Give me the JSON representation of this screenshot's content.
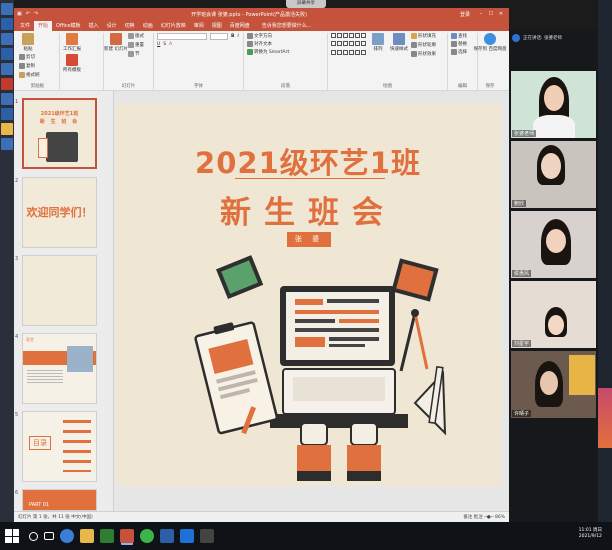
{
  "notice": "屏幕共享",
  "window": {
    "title": "开学班会课 张婆.pptx - PowerPoint(产品激活失败)",
    "sign_in": "登录",
    "qat": [
      "↶",
      "↷",
      "▣"
    ]
  },
  "ribbon_tabs": [
    "文件",
    "开始",
    "Office模板",
    "插入",
    "设计",
    "切换",
    "动画",
    "幻灯片放映",
    "审阅",
    "视图",
    "百度网盘"
  ],
  "tell_me": "告诉我您想要做什么...",
  "ribbon": {
    "clipboard": {
      "name": "剪贴板",
      "paste": "粘贴",
      "cut": "剪切",
      "copy": "复制",
      "format_painter": "格式刷"
    },
    "template": {
      "work_report": "工作汇报",
      "slide_template": "所有模板"
    },
    "slides": {
      "name": "幻灯片",
      "new_slide": "新建\n幻灯片",
      "layout": "版式",
      "reset": "重置",
      "section": "节"
    },
    "font": {
      "name": "字体"
    },
    "paragraph": {
      "name": "段落",
      "text_direction": "文字方向",
      "align_text": "对齐文本",
      "smartart": "转换为 SmartArt"
    },
    "drawing": {
      "name": "绘图",
      "arrange": "排列",
      "quick_styles": "快速样式",
      "fill": "形状填充",
      "outline": "形状轮廓",
      "effects": "形状效果"
    },
    "editing": {
      "name": "编辑",
      "find": "查找",
      "replace": "替换",
      "select": "选择"
    },
    "save": {
      "name": "保存",
      "save_to_cloud": "保存到\n百度网盘"
    }
  },
  "slides_panel": [
    {
      "num": "1",
      "title": "2021级环艺1班",
      "subtitle": "新 生 班 会"
    },
    {
      "num": "2",
      "big": "欢迎同学们！"
    },
    {
      "num": "3"
    },
    {
      "num": "4",
      "label": "导言"
    },
    {
      "num": "5",
      "label": "目录"
    },
    {
      "num": "6",
      "label": "PART 01"
    }
  ],
  "slide": {
    "title": "2021级环艺1班",
    "subtitle": "新生班会",
    "name": "张 婆"
  },
  "status": {
    "left": "幻灯片 第 1 张，共 11 张",
    "lang": "中文(中国)",
    "notes": "备注",
    "comments": "批注",
    "zoom": "86%"
  },
  "meeting": {
    "room": "正在讲话: 张婆老师",
    "participants": [
      {
        "name": "张婆老师",
        "bg": "#cfe3d7",
        "face": "#f1cfb6"
      },
      {
        "name": "鲍欣",
        "bg": "#c9c4bd",
        "face": "#efd4c1"
      },
      {
        "name": "侯惠风",
        "bg": "#d8d2ce",
        "face": "#f0d2bf"
      },
      {
        "name": "刘星宇",
        "bg": "#e5ddd4",
        "face": "#f3d8c6"
      },
      {
        "name": "许晴子",
        "bg": "#6c5a4e",
        "face": "#e8c6ad"
      }
    ]
  },
  "clock": {
    "time": "11:01 周日",
    "date": "2021/9/12"
  },
  "colors": {
    "ppt_red": "#c5523a",
    "accent_orange": "#e0703e",
    "slide_bg": "#efe7d4"
  }
}
